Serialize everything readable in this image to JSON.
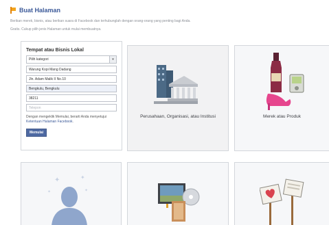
{
  "header": {
    "title": "Buat Halaman",
    "description": "Berikan merek, bisnis, atau berikan suara di Facebook dan terhubunglah dengan orang-orang yang penting bagi Anda.",
    "note": "Gratis. Cukup pilih jenis Halaman untuk mulai membuatnya."
  },
  "form": {
    "title": "Tempat atau Bisnis Lokal",
    "category_select": "Pilih kategori",
    "name": "Warung Kopi Mang Dadang",
    "address": "Jln. Adam Malik II No.10",
    "city": "Bengkulu, Bengkulu",
    "postal_code": "38211",
    "phone_placeholder": "Telepon",
    "terms_text": "Dengan mengeklik Memulai, berarti Anda menyetujui",
    "terms_link": "Ketentuan Halaman Facebook",
    "terms_end": ".",
    "submit_label": "Memulai"
  },
  "tiles": [
    {
      "label": "Perusahaan, Organisasi, atau Institusi",
      "icon": "building-icon"
    },
    {
      "label": "Merek atau Produk",
      "icon": "products-icon"
    },
    {
      "label": "",
      "icon": "public-figure-icon"
    },
    {
      "label": "",
      "icon": "entertainment-icon"
    },
    {
      "label": "",
      "icon": "cause-icon"
    }
  ],
  "colors": {
    "brand": "#3b5998",
    "button": "#4e69a2",
    "flag": "#f2a51e"
  }
}
